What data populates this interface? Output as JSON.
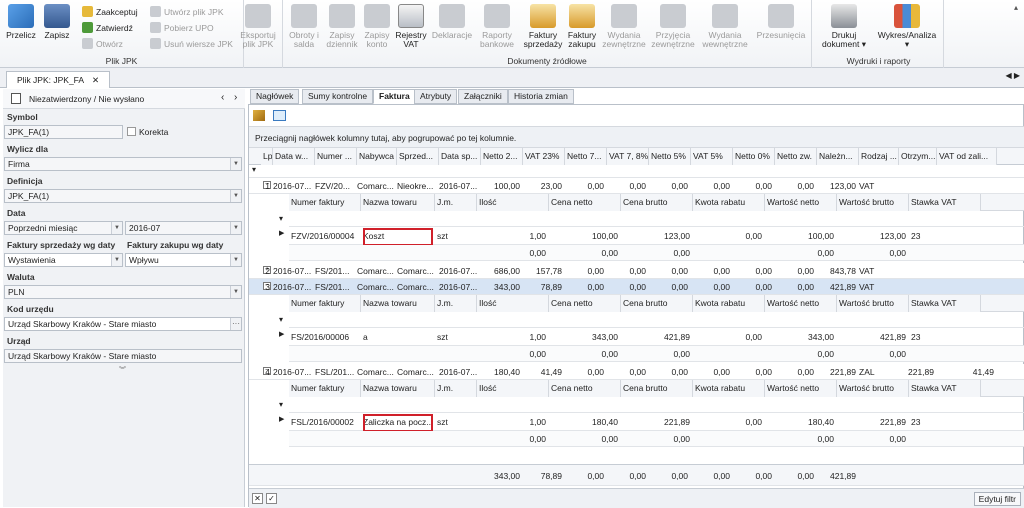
{
  "ribbon": {
    "przelicz": "Przelicz",
    "zapisz": "Zapisz",
    "zaakceptuj": "Zaakceptuj",
    "zatwierdz": "Zatwierdź",
    "otworz": "Otwórz",
    "utworz_plik": "Utwórz plik JPK",
    "pobierz_upo": "Pobierz UPO",
    "usun_wiersze": "Usuń wiersze JPK",
    "eksportuj": "Eksportuj plik JPK",
    "group_plik": "Plik JPK",
    "obroty": "Obroty i salda",
    "zapisy_dziennik": "Zapisy dziennik",
    "zapisy_konto": "Zapisy konto",
    "rejestry_vat": "Rejestry VAT",
    "deklaracje": "Deklaracje",
    "raporty_bankowe": "Raporty bankowe",
    "faktury_sprzedazy": "Faktury sprzedaży",
    "faktury_zakupu": "Faktury zakupu",
    "wydania_zewn": "Wydania zewnętrzne",
    "przyjecia_zewn": "Przyjęcia zewnętrzne",
    "wydania_wewn": "Wydania wewnętrzne",
    "przesuniecia": "Przesunięcia",
    "group_dokumenty": "Dokumenty źródłowe",
    "drukuj": "Drukuj dokument",
    "wykres": "Wykres/Analiza",
    "group_wydruki": "Wydruki i raporty"
  },
  "doc_tab": "Plik JPK: JPK_FA",
  "left": {
    "status": "Niezatwierdzony / Nie wysłano",
    "symbol_label": "Symbol",
    "symbol_value": "JPK_FA(1)",
    "korekta": "Korekta",
    "wylicz_label": "Wylicz dla",
    "wylicz_value": "Firma",
    "definicja_label": "Definicja",
    "definicja_value": "JPK_FA(1)",
    "data_label": "Data",
    "data_okres": "Poprzedni miesiąc",
    "data_value": "2016-07",
    "fs_label": "Faktury sprzedaży wg daty",
    "fs_value": "Wystawienia",
    "fz_label": "Faktury zakupu wg daty",
    "fz_value": "Wpływu",
    "waluta_label": "Waluta",
    "waluta_value": "PLN",
    "kod_urzedu_label": "Kod urzędu",
    "kod_urzedu_value": "Urząd Skarbowy Kraków - Stare miasto",
    "urzad_label": "Urząd",
    "urzad_value": "Urząd Skarbowy Kraków - Stare miasto"
  },
  "tabs": [
    "Nagłówek",
    "Sumy kontrolne",
    "Faktura",
    "Atrybuty",
    "Załączniki",
    "Historia zmian"
  ],
  "group_hint": "Przeciągnij nagłówek kolumny tutaj, aby pogrupować po tej kolumnie.",
  "main_headers": [
    "Lp.",
    "Data w...",
    "Numer ...",
    "Nabywca",
    "Sprzed...",
    "Data sp...",
    "Netto 2...",
    "VAT 23%",
    "Netto 7...",
    "VAT 7, 8%",
    "Netto 5%",
    "VAT 5%",
    "Netto 0%",
    "Netto zw.",
    "Należn...",
    "Rodzaj ...",
    "Otrzym...",
    "VAT od zali..."
  ],
  "sub_headers": [
    "Numer faktury",
    "Nazwa towaru",
    "J.m.",
    "Ilość",
    "Cena netto",
    "Cena brutto",
    "Kwota rabatu",
    "Wartość netto",
    "Wartość brutto",
    "Stawka VAT"
  ],
  "rows": [
    {
      "main": [
        "1",
        "2016-07...",
        "FZV/20...",
        "Comarc...",
        "Nieokre...",
        "2016-07...",
        "100,00",
        "23,00",
        "0,00",
        "0,00",
        "0,00",
        "0,00",
        "0,00",
        "0,00",
        "123,00",
        "VAT",
        "",
        ""
      ],
      "sub": [
        "FZV/2016/00004",
        "Koszt",
        "szt",
        "1,00",
        "100,00",
        "123,00",
        "0,00",
        "100,00",
        "123,00",
        "23"
      ],
      "sub_total": [
        "0,00",
        "0,00",
        "0,00",
        "0,00",
        "0,00"
      ]
    },
    {
      "main": [
        "2",
        "2016-07...",
        "FS/201...",
        "Comarc...",
        "Comarc...",
        "2016-07...",
        "686,00",
        "157,78",
        "0,00",
        "0,00",
        "0,00",
        "0,00",
        "0,00",
        "0,00",
        "843,78",
        "VAT",
        "",
        ""
      ]
    },
    {
      "main": [
        "3",
        "2016-07...",
        "FS/201...",
        "Comarc...",
        "Comarc...",
        "2016-07...",
        "343,00",
        "78,89",
        "0,00",
        "0,00",
        "0,00",
        "0,00",
        "0,00",
        "0,00",
        "421,89",
        "VAT",
        "",
        ""
      ],
      "sub": [
        "FS/2016/00006",
        "a",
        "szt",
        "1,00",
        "343,00",
        "421,89",
        "0,00",
        "343,00",
        "421,89",
        "23"
      ],
      "sub_total": [
        "0,00",
        "0,00",
        "0,00",
        "0,00",
        "0,00"
      ]
    },
    {
      "main": [
        "4",
        "2016-07...",
        "FSL/201...",
        "Comarc...",
        "Comarc...",
        "2016-07...",
        "180,40",
        "41,49",
        "0,00",
        "0,00",
        "0,00",
        "0,00",
        "0,00",
        "0,00",
        "221,89",
        "ZAL",
        "221,89",
        "41,49"
      ],
      "sub": [
        "FSL/2016/00002",
        "Zaliczka na pocz...",
        "szt",
        "1,00",
        "180,40",
        "221,89",
        "0,00",
        "180,40",
        "221,89",
        "23"
      ],
      "sub_total": [
        "0,00",
        "0,00",
        "0,00",
        "0,00",
        "0,00"
      ]
    }
  ],
  "footer_totals": [
    "343,00",
    "78,89",
    "0,00",
    "0,00",
    "0,00",
    "0,00",
    "0,00",
    "0,00",
    "421,89"
  ],
  "edit_filter": "Edytuj filtr",
  "colors": {
    "accent": "#3c6db0",
    "red_box": "#d0202a"
  }
}
